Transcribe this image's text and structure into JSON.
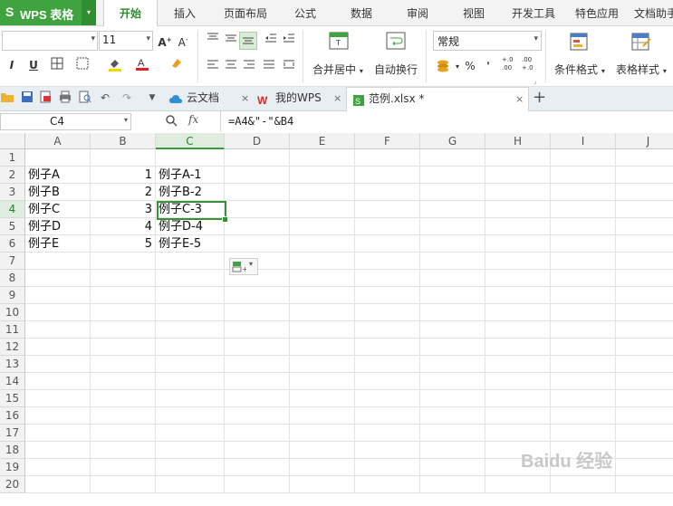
{
  "app": {
    "logo": "S",
    "name": "WPS 表格",
    "menu_arrow": "▾"
  },
  "menu_tabs": [
    "开始",
    "插入",
    "页面布局",
    "公式",
    "数据",
    "审阅",
    "视图",
    "开发工具",
    "特色应用",
    "文档助手"
  ],
  "ribbon": {
    "font_name": "",
    "font_size": "11",
    "merge_center_label": "合并居中",
    "auto_wrap_label": "自动换行",
    "number_format": "常规",
    "conditional_format_label": "条件格式",
    "table_style_label": "表格样式",
    "dropdown_arrow": "▾",
    "percent": "%",
    "thousands": "'",
    "dec_inc": "+.0\n.00",
    "dec_dec": ".00\n+.0"
  },
  "doc_tabs": [
    {
      "label": "云文档",
      "icon": "cloud-icon"
    },
    {
      "label": "我的WPS",
      "icon": "wps-icon"
    },
    {
      "label": "范例.xlsx *",
      "icon": "spreadsheet-icon"
    }
  ],
  "formula_bar": {
    "name_box": "C4",
    "fx": "fx",
    "formula": "=A4&\"-\"&B4"
  },
  "columns": [
    "A",
    "B",
    "C",
    "D",
    "E",
    "F",
    "G",
    "H",
    "I",
    "J"
  ],
  "rows": [
    "1",
    "2",
    "3",
    "4",
    "5",
    "6",
    "7",
    "8",
    "9",
    "10",
    "11",
    "12",
    "13",
    "14",
    "15",
    "16",
    "17",
    "18",
    "19",
    "20"
  ],
  "cells": {
    "A2": "例子A",
    "B2": "1",
    "C2": "例子A-1",
    "A3": "例子B",
    "B3": "2",
    "C3": "例子B-2",
    "A4": "例子C",
    "B4": "3",
    "C4": "例子C-3",
    "A5": "例子D",
    "B5": "4",
    "C5": "例子D-4",
    "A6": "例子E",
    "B6": "5",
    "C6": "例子E-5"
  },
  "watermark": "Baidu 经验",
  "colors": {
    "accent_green": "#3fa33f",
    "selection": "#3a8f3a"
  }
}
